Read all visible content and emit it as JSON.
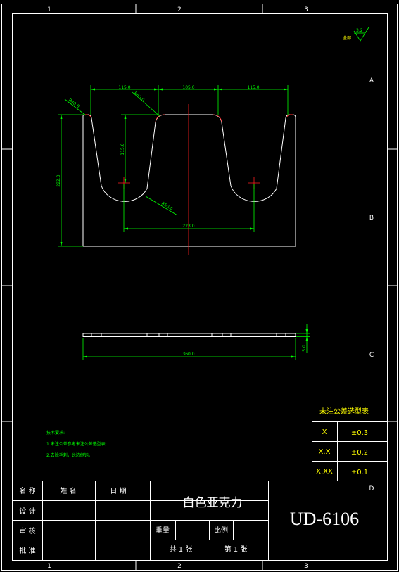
{
  "border": {
    "columns": [
      "1",
      "2",
      "3"
    ],
    "rows": [
      "A",
      "B",
      "C",
      "D"
    ]
  },
  "roughness": {
    "value": "3.2",
    "label": "全部"
  },
  "dimensions": {
    "top_left": "115.0",
    "top_mid": "105.0",
    "top_right": "115.0",
    "angle_radius": "R40.0",
    "radius_mid": "R50.0",
    "depth": "115.0",
    "height": "222.0",
    "bottom_radius": "R60.0",
    "center_span": "223.0",
    "width": "360.0",
    "thickness": "5.0"
  },
  "tolerance_table": {
    "title": "未注公差选型表",
    "rows": [
      {
        "grade": "X",
        "tol": "±0.3"
      },
      {
        "grade": "X.X",
        "tol": "±0.2"
      },
      {
        "grade": "X.XX",
        "tol": "±0.1"
      }
    ]
  },
  "notes": {
    "title": "技术要求:",
    "items": [
      "1.未注公差参考未注公差选型表;",
      "2.去除毛刺，锐边倒钝。"
    ]
  },
  "title_block": {
    "name_label": "名 称",
    "name_value": "姓 名",
    "date_label": "日 期",
    "design_label": "设 计",
    "review_label": "审 核",
    "approve_label": "批 准",
    "material": "白色亚克力",
    "weight_label": "重量",
    "scale_label": "比例",
    "total_sheets": "共 1 张",
    "sheet_no": "第 1 张",
    "drawing_no": "UD-6106"
  }
}
